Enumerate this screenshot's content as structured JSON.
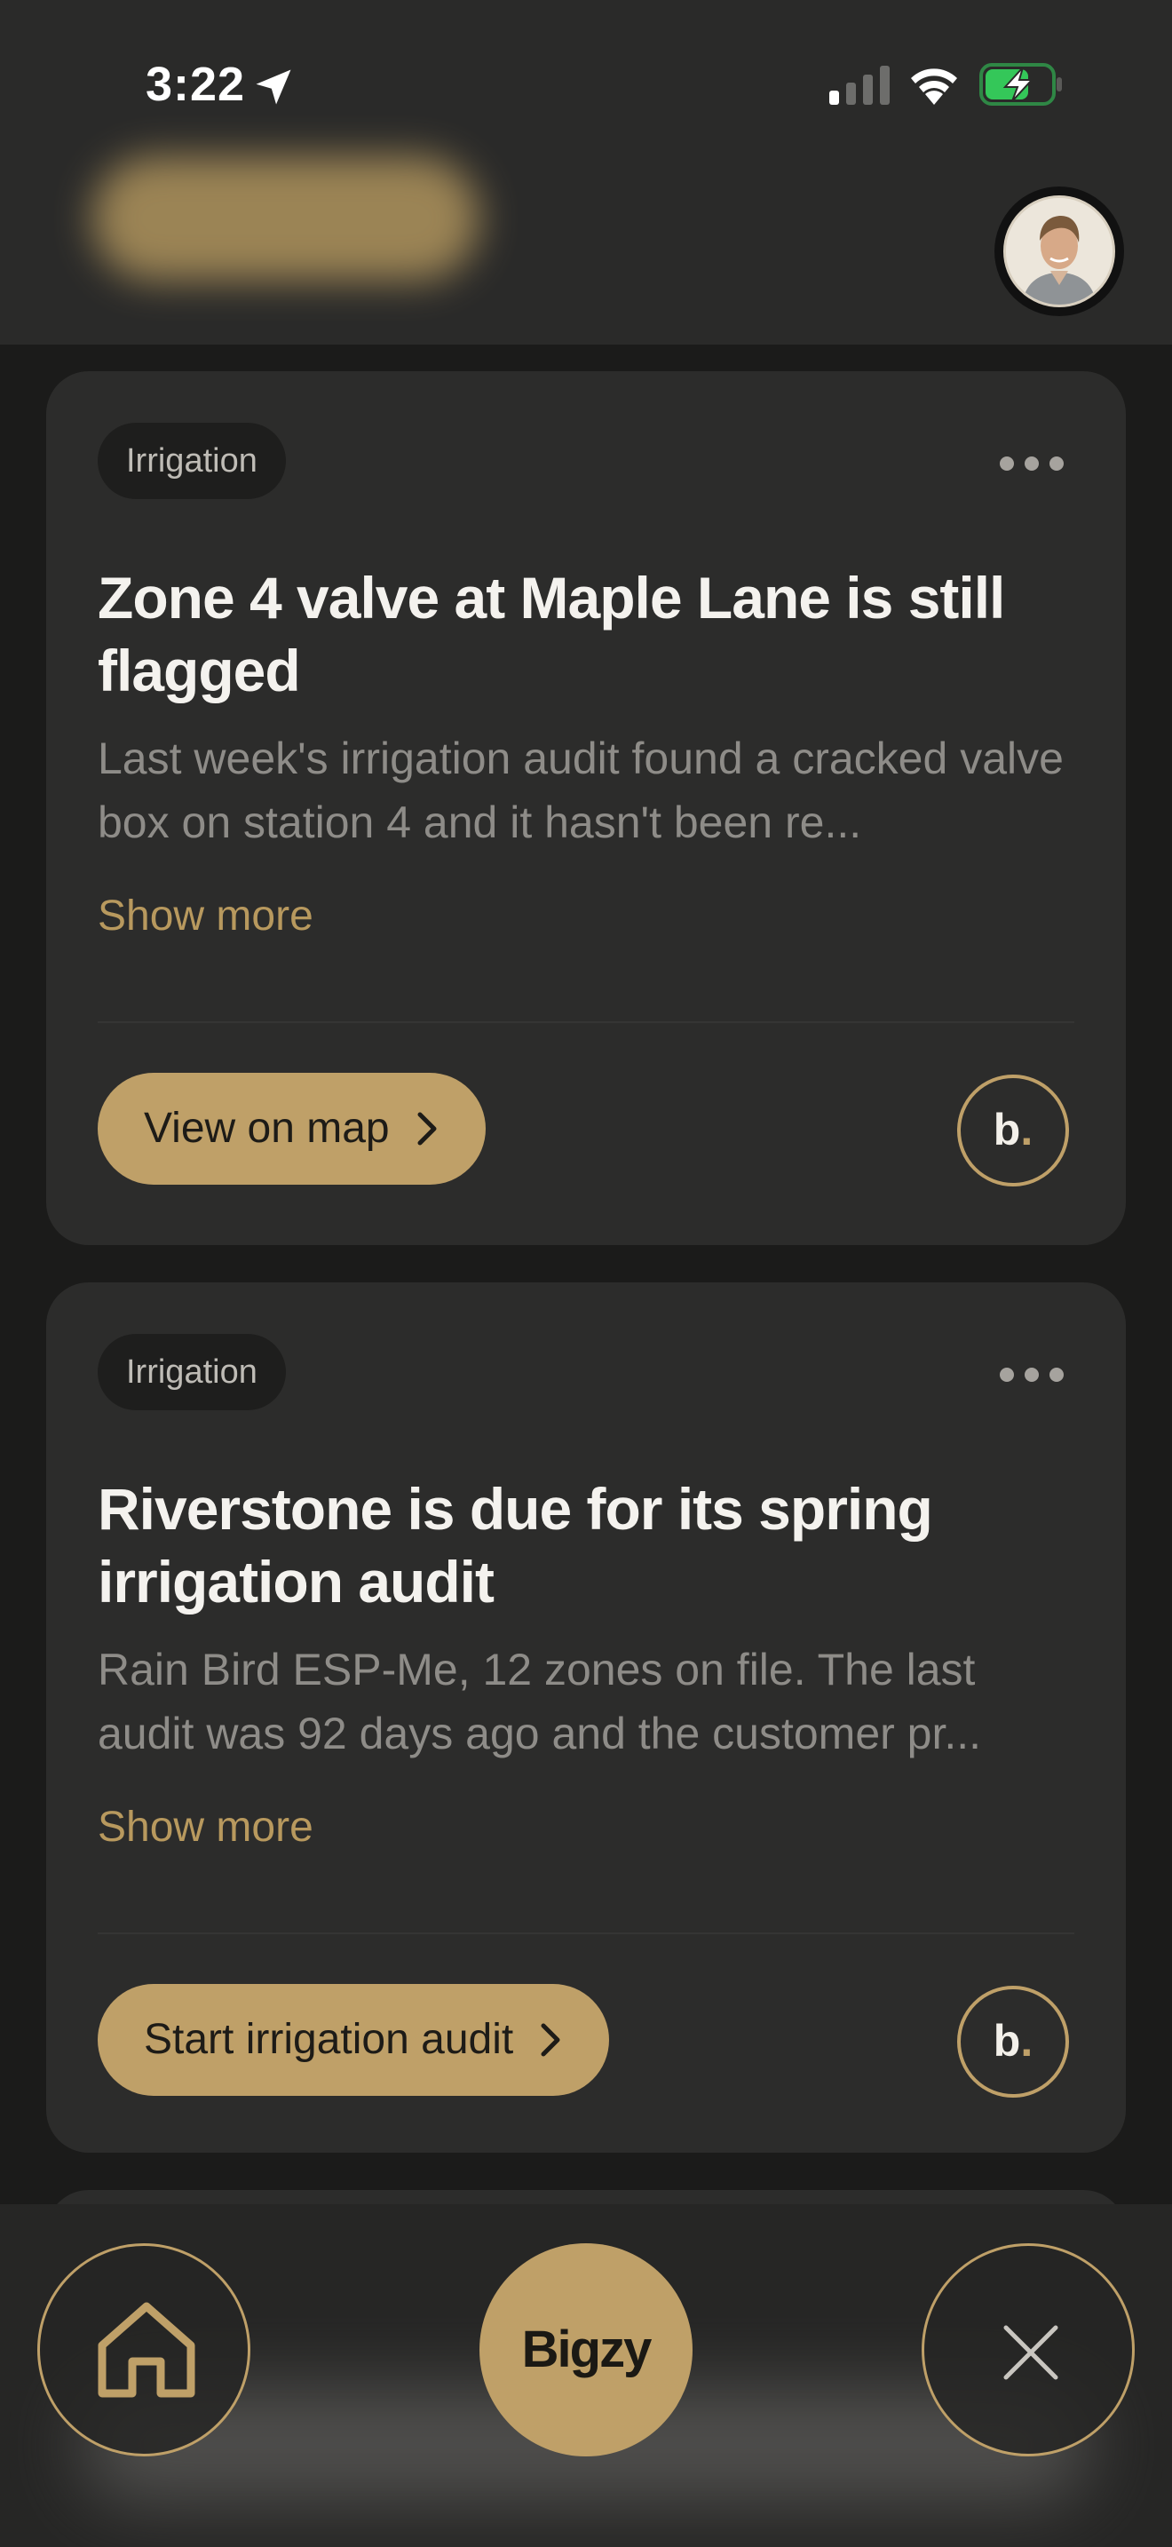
{
  "status_bar": {
    "time": "3:22",
    "icons": [
      "location-arrow-icon",
      "signal-icon",
      "wifi-icon",
      "battery-charging-icon"
    ]
  },
  "header": {
    "avatar_alt": "User profile photo"
  },
  "cards": [
    {
      "tag": "Irrigation",
      "title": "Zone 4 valve at Maple Lane is still flagged",
      "description": "Last week's irrigation audit found a cracked valve box on station 4 and it hasn't been re...",
      "show_more": "Show more",
      "action": "View on map",
      "brand_mark": "b",
      "brand_dot": "."
    },
    {
      "tag": "Irrigation",
      "title": "Riverstone is due for its spring irrigation audit",
      "description": "Rain Bird ESP-Me, 12 zones on file. The last audit was 92 days ago and the customer pr...",
      "show_more": "Show more",
      "action": "Start irrigation audit",
      "brand_mark": "b",
      "brand_dot": "."
    }
  ],
  "bottom_nav": {
    "center_label": "Bigzy"
  },
  "colors": {
    "accent_gold": "#bfa068",
    "background": "#1b1b1a",
    "card": "#2c2c2b",
    "title_text": "#f4f2ee",
    "muted_text": "#8e8c88"
  }
}
